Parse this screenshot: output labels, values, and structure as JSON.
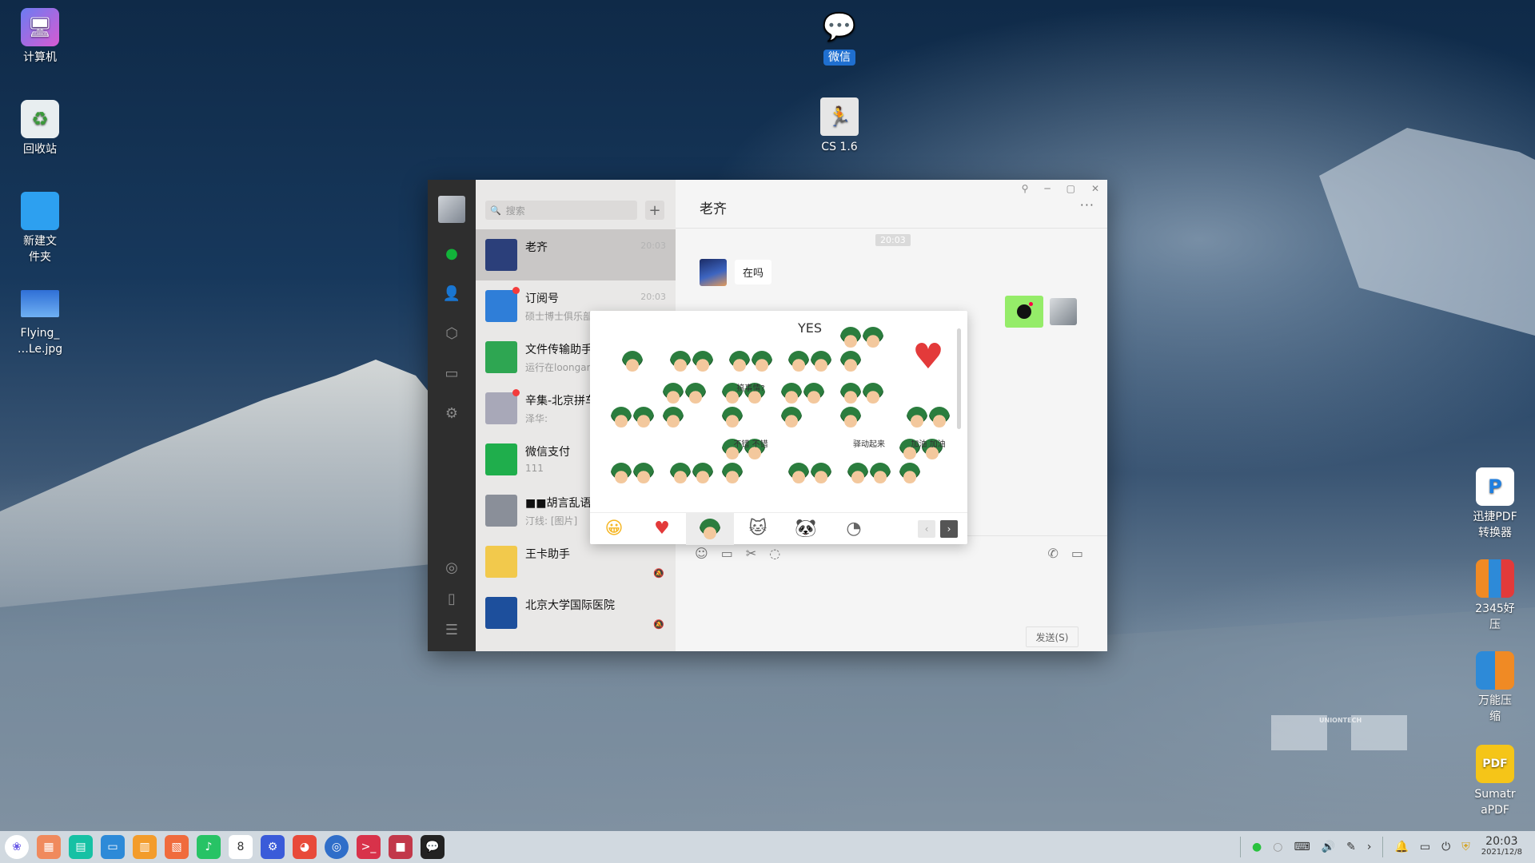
{
  "desktop": {
    "left_icons": [
      {
        "label": "计算机",
        "icon": "computer-icon"
      },
      {
        "label": "回收站",
        "icon": "trash-icon"
      },
      {
        "label": "新建文件夹",
        "line1": "新建文",
        "line2": "件夹",
        "icon": "folder-icon"
      },
      {
        "label": "Flying_…Le.jpg",
        "line1": "Flying_",
        "line2": "…Le.jpg",
        "icon": "image-icon"
      }
    ],
    "center_icons": [
      {
        "label": "微信",
        "icon": "wechat-icon"
      },
      {
        "label": "CS 1.6",
        "icon": "cs-game-icon"
      }
    ],
    "right_icons": [
      {
        "line1": "迅捷PDF",
        "line2": "转换器",
        "icon": "pdf-converter-icon"
      },
      {
        "line1": "2345好",
        "line2": "压",
        "icon": "archive-icon"
      },
      {
        "line1": "万能压",
        "line2": "缩",
        "icon": "compress-icon"
      },
      {
        "line1": "Sumatr",
        "line2": "aPDF",
        "icon": "sumatra-pdf-icon"
      }
    ],
    "watermark": "UNIONTECH"
  },
  "wechat": {
    "search_placeholder": "搜索",
    "add_label": "+",
    "chats": [
      {
        "name": "老齐",
        "preview": "",
        "time": "20:03",
        "unread": false,
        "muted": false,
        "active": true,
        "avatar_color": "#2b3f7a"
      },
      {
        "name": "订阅号",
        "preview": "硕士博士俱乐部",
        "time": "20:03",
        "unread": true,
        "muted": false,
        "active": false,
        "avatar_color": "#2f7ed8"
      },
      {
        "name": "文件传输助手",
        "preview": "运行在loongarch",
        "time": "",
        "unread": false,
        "muted": false,
        "active": false,
        "avatar_color": "#2ea652"
      },
      {
        "name": "辛集-北京拼车",
        "preview": "泽华: ",
        "time": "",
        "unread": true,
        "muted": false,
        "active": false,
        "avatar_color": "#a8a8b8"
      },
      {
        "name": "微信支付",
        "preview": "111",
        "time": "",
        "unread": false,
        "muted": false,
        "active": false,
        "avatar_color": "#1fae4c"
      },
      {
        "name": "■■胡言乱语",
        "preview": "汀线: [图片]",
        "time": "",
        "unread": false,
        "muted": false,
        "active": false,
        "avatar_color": "#8a8f99"
      },
      {
        "name": "王卡助手",
        "preview": "",
        "time": "",
        "unread": false,
        "muted": true,
        "active": false,
        "avatar_color": "#f2c94c"
      },
      {
        "name": "北京大学国际医院",
        "preview": "",
        "time": "",
        "unread": false,
        "muted": true,
        "active": false,
        "avatar_color": "#1d4f9c"
      }
    ],
    "conversation": {
      "title": "老齐",
      "more": "···",
      "time_chip": "20:03",
      "incoming_text": "在吗",
      "send_label": "发送(S)"
    },
    "stickers": {
      "captions": [
        "",
        "",
        "",
        "YES",
        "",
        "",
        "",
        "",
        "搞事情?",
        "",
        "",
        "",
        "",
        "",
        "不错 不错",
        "",
        "驿动起来",
        "加油 加油"
      ],
      "tabs": [
        "emoji-tab",
        "heart-tab",
        "soldier-tab",
        "cat-tab",
        "panda-tab",
        "bun-tab"
      ],
      "pager_prev": "‹",
      "pager_next": "›"
    }
  },
  "taskbar": {
    "time": "20:03",
    "date": "2021/12/8"
  }
}
